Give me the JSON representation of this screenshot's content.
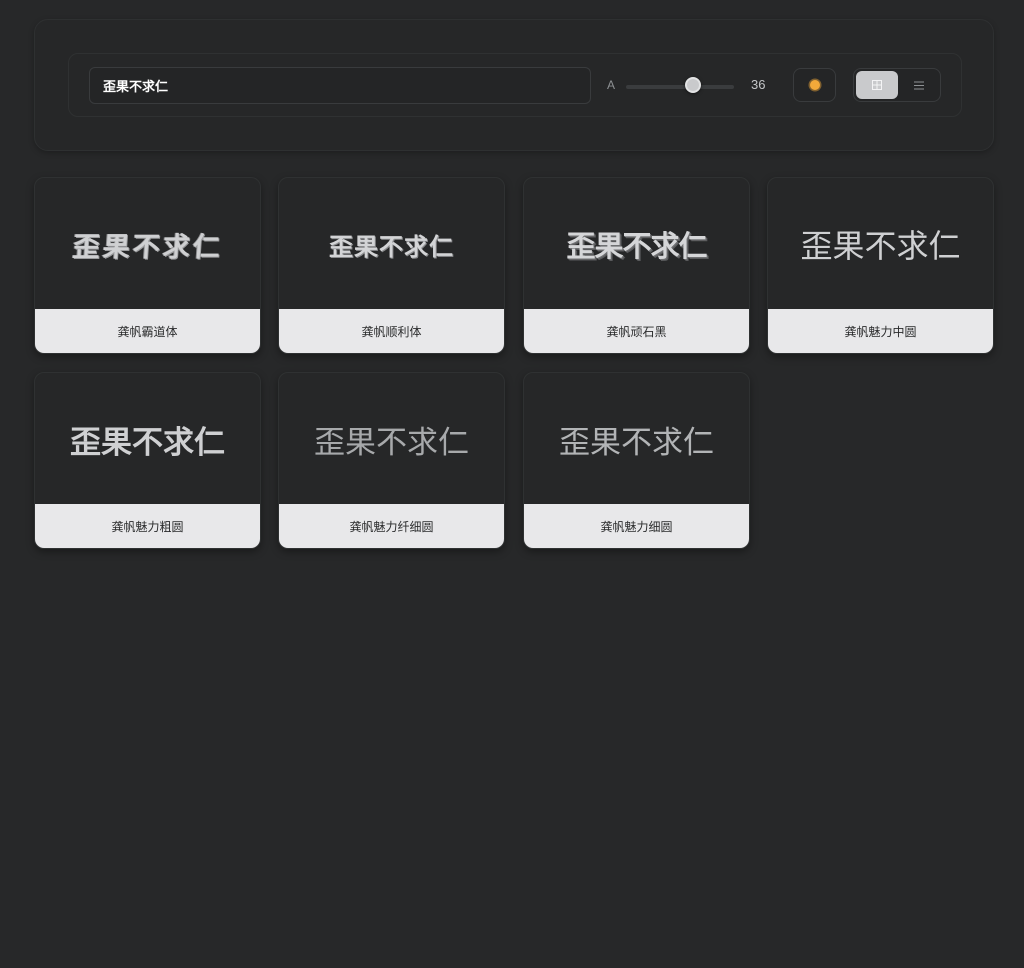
{
  "toolbar": {
    "preview_text": "歪果不求仁",
    "size_label": "A",
    "font_size": "36",
    "slider_value": 0.62,
    "theme_icon": "sun-icon",
    "view_mode": "grid",
    "grid_icon": "grid-icon",
    "list_icon": "list-icon"
  },
  "cards": [
    {
      "preview": "歪果不求仁",
      "label": "龚帆霸道体"
    },
    {
      "preview": "歪果不求仁",
      "label": "龚帆顺利体"
    },
    {
      "preview": "歪果不求仁",
      "label": "龚帆顽石黑"
    },
    {
      "preview": "歪果不求仁",
      "label": "龚帆魅力中圆"
    },
    {
      "preview": "歪果不求仁",
      "label": "龚帆魅力粗圆"
    },
    {
      "preview": "歪果不求仁",
      "label": "龚帆魅力纤细圆"
    },
    {
      "preview": "歪果不求仁",
      "label": "龚帆魅力细圆"
    }
  ],
  "colors": {
    "background": "#272829",
    "card_label_background": "#e8e8ea",
    "accent_sun": "#f2a93a",
    "active_toggle": "#c9cacc"
  }
}
